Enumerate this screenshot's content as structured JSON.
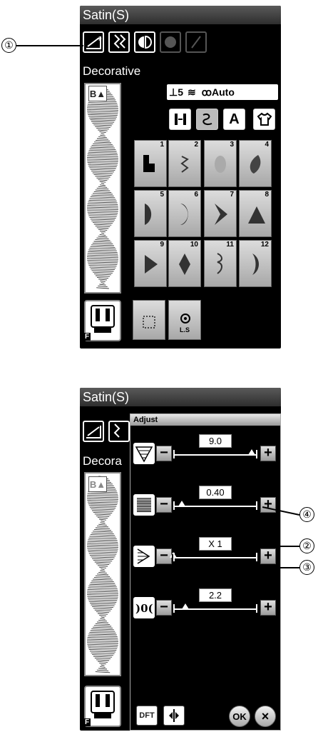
{
  "top": {
    "title": "Satin(S)",
    "category": "Decorative",
    "preview_button": "B▲",
    "info_stitch_length": "5",
    "info_tension": "Auto",
    "patterns": [
      {
        "num": "1",
        "icon": "step-shape-icon"
      },
      {
        "num": "2",
        "icon": "zigzag-shape-icon"
      },
      {
        "num": "3",
        "icon": "oval-shape-icon"
      },
      {
        "num": "4",
        "icon": "leaf-shape-icon"
      },
      {
        "num": "5",
        "icon": "half-circle-shape-icon"
      },
      {
        "num": "6",
        "icon": "crescent-shape-icon"
      },
      {
        "num": "7",
        "icon": "chevron-shape-icon"
      },
      {
        "num": "8",
        "icon": "triangle-shape-icon"
      },
      {
        "num": "9",
        "icon": "arrow-shape-icon"
      },
      {
        "num": "10",
        "icon": "diamond-shape-icon"
      },
      {
        "num": "11",
        "icon": "wave-shape-icon"
      },
      {
        "num": "12",
        "icon": "moon-shape-icon"
      }
    ],
    "ls_label": "L.S",
    "foot_label": "F"
  },
  "bottom": {
    "title": "Satin(S)",
    "category": "Decora",
    "panel_title": "Adjust",
    "settings": [
      {
        "name": "width",
        "value": "9.0",
        "fraction": 0.95
      },
      {
        "name": "density",
        "value": "0.40",
        "fraction": 0.1
      },
      {
        "name": "elongation",
        "value": "X 1",
        "fraction": 0.0
      },
      {
        "name": "length",
        "value": "2.2",
        "fraction": 0.15
      }
    ],
    "dft_label": "DFT",
    "ok_label": "OK",
    "cancel_label": "×",
    "foot_label": "F"
  },
  "callouts": [
    "①",
    "②",
    "③",
    "④"
  ],
  "colors": {
    "screen_bg": "#000000",
    "button_gray": "#b4b4b4",
    "white": "#ffffff"
  }
}
